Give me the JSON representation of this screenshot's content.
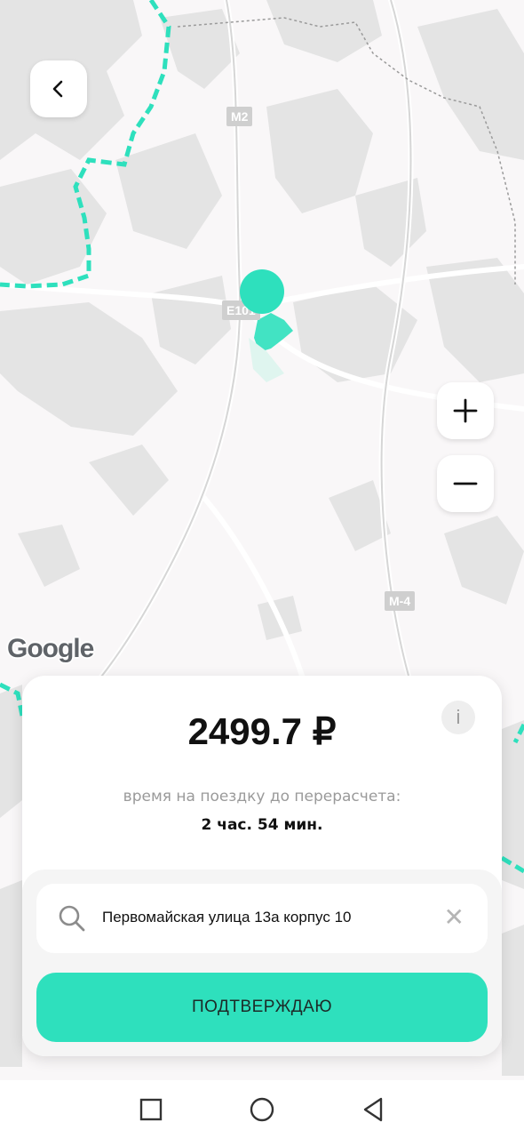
{
  "map": {
    "road_labels": [
      "M2",
      "E101",
      "M-4"
    ],
    "attribution": "Google"
  },
  "controls": {
    "back_icon": "chevron-left-icon",
    "zoom_in_icon": "plus-icon",
    "zoom_out_icon": "minus-icon"
  },
  "sheet": {
    "price": "2499.7 ₽",
    "info_label": "i",
    "time_label": "время на поездку до перерасчета:",
    "time_value": "2 час. 54 мин.",
    "search": {
      "value": "Первомайская улица 13а корпус 10",
      "clear_label": "✕"
    },
    "confirm_label": "ПОДТВЕРЖДАЮ"
  },
  "nav": {
    "recent_icon": "square-icon",
    "home_icon": "circle-icon",
    "back_icon": "triangle-back-icon"
  },
  "colors": {
    "accent": "#2ee0bd",
    "map_background": "#f9f7f8"
  }
}
